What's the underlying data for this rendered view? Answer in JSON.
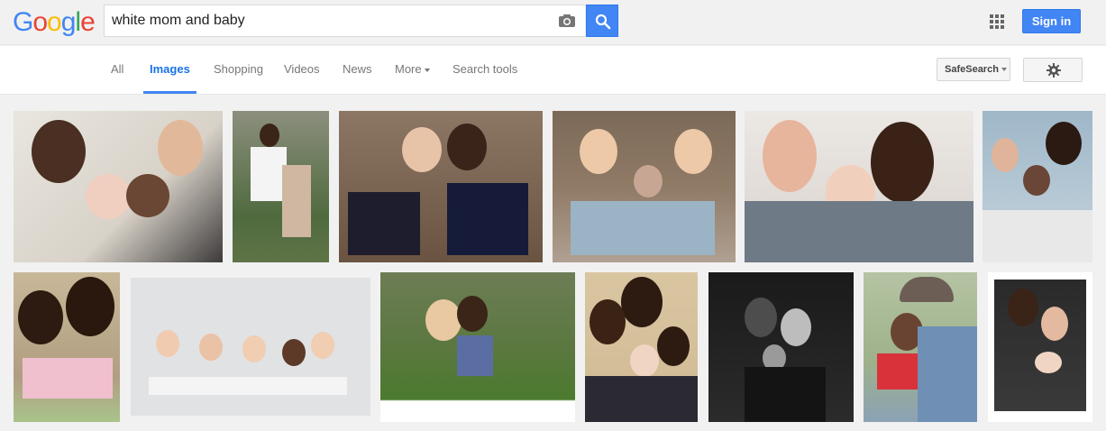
{
  "header": {
    "logo_letters": [
      {
        "char": "G",
        "color": "#4285f4"
      },
      {
        "char": "o",
        "color": "#ea4335"
      },
      {
        "char": "o",
        "color": "#fbbc05"
      },
      {
        "char": "g",
        "color": "#4285f4"
      },
      {
        "char": "l",
        "color": "#34a853"
      },
      {
        "char": "e",
        "color": "#ea4335"
      }
    ],
    "search_value": "white mom and baby",
    "signin_label": "Sign in",
    "accent_color": "#4285f4"
  },
  "nav": {
    "tabs": [
      {
        "label": "All",
        "active": false
      },
      {
        "label": "Images",
        "active": true
      },
      {
        "label": "Shopping",
        "active": false
      },
      {
        "label": "Videos",
        "active": false
      },
      {
        "label": "News",
        "active": false
      },
      {
        "label": "More",
        "active": false
      },
      {
        "label": "Search tools",
        "active": false
      }
    ],
    "safesearch_label": "SafeSearch"
  },
  "results": {
    "images": [
      {
        "icon": "family-photo"
      },
      {
        "icon": "family-photo"
      },
      {
        "icon": "family-photo"
      },
      {
        "icon": "family-photo"
      },
      {
        "icon": "family-photo"
      },
      {
        "icon": "family-photo"
      },
      {
        "icon": "family-photo"
      },
      {
        "icon": "babies-photo"
      },
      {
        "icon": "family-photo"
      },
      {
        "icon": "family-photo"
      },
      {
        "icon": "family-photo"
      },
      {
        "icon": "family-photo"
      },
      {
        "icon": "family-photo"
      }
    ]
  }
}
